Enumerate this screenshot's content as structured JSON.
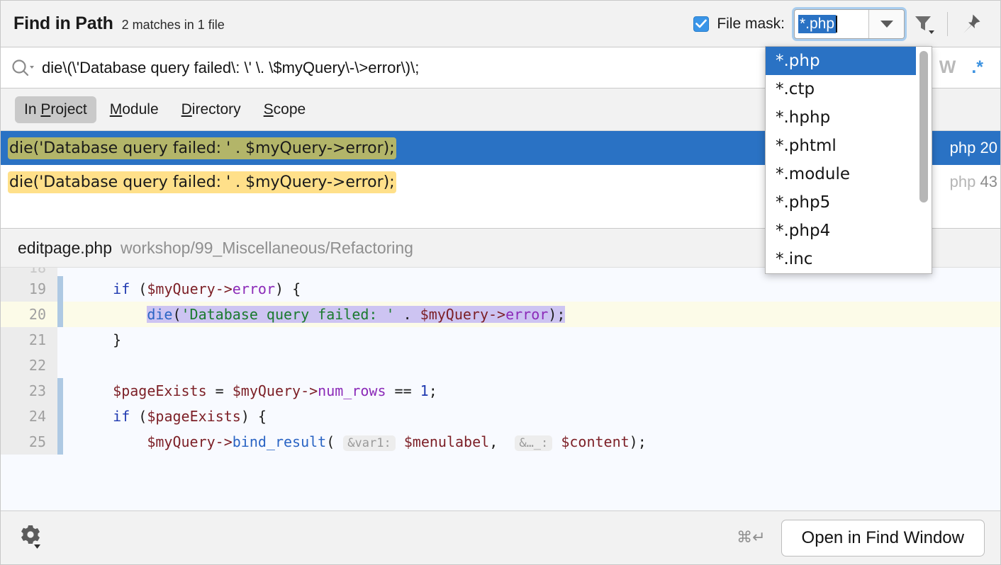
{
  "header": {
    "title": "Find in Path",
    "match_summary": "2 matches in 1 file",
    "file_mask_label": "File mask:",
    "file_mask_value": "*.php",
    "checkbox_checked": true,
    "icons": {
      "filter": "filter-icon",
      "pin": "pin-icon",
      "dropdown_arrow": "chevron-down-icon"
    }
  },
  "search": {
    "query": "die\\(\\'Database query failed\\: \\' \\. \\$myQuery\\-\\>error\\)\\;",
    "search_icon": "search-icon",
    "toggle_words": "W",
    "toggle_regex": ".*"
  },
  "scope_tabs": [
    {
      "prefix": "In ",
      "mnemonic": "P",
      "suffix": "roject",
      "selected": true
    },
    {
      "prefix": "",
      "mnemonic": "M",
      "suffix": "odule",
      "selected": false
    },
    {
      "prefix": "",
      "mnemonic": "D",
      "suffix": "irectory",
      "selected": false
    },
    {
      "prefix": "",
      "mnemonic": "S",
      "suffix": "cope",
      "selected": false
    }
  ],
  "results": [
    {
      "match": "die('Database query failed: ' . $myQuery->error);",
      "file": "php",
      "line": "20",
      "selected": true
    },
    {
      "match": "die('Database query failed: ' . $myQuery->error);",
      "file": "php",
      "line": "43",
      "selected": false
    }
  ],
  "dropdown": {
    "items": [
      {
        "label": "*.php",
        "selected": true
      },
      {
        "label": "*.ctp",
        "selected": false
      },
      {
        "label": "*.hphp",
        "selected": false
      },
      {
        "label": "*.phtml",
        "selected": false
      },
      {
        "label": "*.module",
        "selected": false
      },
      {
        "label": "*.php5",
        "selected": false
      },
      {
        "label": "*.php4",
        "selected": false
      },
      {
        "label": "*.inc",
        "selected": false
      }
    ]
  },
  "preview": {
    "file_name": "editpage.php",
    "directory": "workshop/99_Miscellaneous/Refactoring",
    "lines": [
      {
        "number": "19",
        "changed": true,
        "highlight": false
      },
      {
        "number": "20",
        "changed": true,
        "highlight": true
      },
      {
        "number": "21",
        "changed": false,
        "highlight": false
      },
      {
        "number": "22",
        "changed": false,
        "highlight": false
      },
      {
        "number": "23",
        "changed": true,
        "highlight": false
      },
      {
        "number": "24",
        "changed": true,
        "highlight": false
      },
      {
        "number": "25",
        "changed": true,
        "highlight": false
      }
    ],
    "code": {
      "l19_kw": "if",
      "l19_a": " (",
      "l19_var": "$myQuery",
      "l19_arrow": "->",
      "l19_prop": "error",
      "l19_b": ") {",
      "l20_fn": "die",
      "l20_a": "(",
      "l20_str": "'Database query failed: '",
      "l20_b": " . ",
      "l20_var": "$myQuery",
      "l20_arrow": "->",
      "l20_prop": "error",
      "l20_c": ");",
      "l21": "}",
      "l22": "",
      "l23_var": "$pageExists",
      "l23_a": " = ",
      "l23_var2": "$myQuery",
      "l23_arrow": "->",
      "l23_prop": "num_rows",
      "l23_b": " == ",
      "l23_num": "1",
      "l23_c": ";",
      "l24_kw": "if",
      "l24_a": " (",
      "l24_var": "$pageExists",
      "l24_b": ") {",
      "l25_var": "$myQuery",
      "l25_arrow": "->",
      "l25_fn": "bind_result",
      "l25_a": "(",
      "l25_hint1": "&var1:",
      "l25_var2": "$menulabel",
      "l25_b": ", ",
      "l25_hint2": "&…_:",
      "l25_var3": "$content",
      "l25_c": ");"
    }
  },
  "bottom": {
    "settings_icon": "gear-icon",
    "shortcut": "⌘↵",
    "open_button": "Open in Find Window"
  }
}
